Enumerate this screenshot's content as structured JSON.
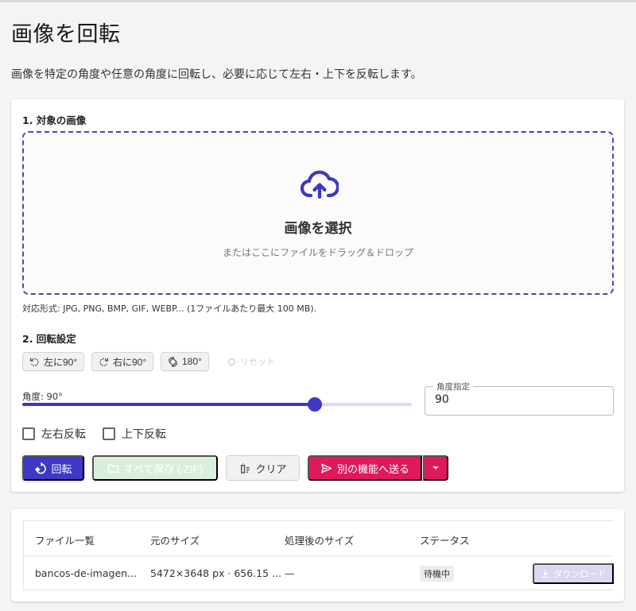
{
  "page": {
    "title": "画像を回転",
    "description": "画像を特定の角度や任意の角度に回転し、必要に応じて左右・上下を反転します。"
  },
  "upload": {
    "section_title": "1. 対象の画像",
    "dropzone_title": "画像を選択",
    "dropzone_subtitle": "またはここにファイルをドラッグ＆ドロップ",
    "formats_note": "対応形式: JPG, PNG, BMP, GIF, WEBP... (1ファイルあたり最大 100 MB).",
    "icon": "cloud-upload-icon"
  },
  "rotation": {
    "section_title": "2. 回転設定",
    "buttons": {
      "left90": "左に90°",
      "right90": "右に90°",
      "rotate180": "180°",
      "reset": "リセット"
    },
    "slider_label": "角度: 90°",
    "slider_value": 90,
    "slider_min": -180,
    "slider_max": 180,
    "angle_field_label": "角度指定",
    "angle_field_value": "90",
    "flip_horizontal_label": "左右反転",
    "flip_vertical_label": "上下反転",
    "flip_horizontal_checked": false,
    "flip_vertical_checked": false
  },
  "actions": {
    "rotate": "回転",
    "save_all": "すべて保存 (.ZIP)",
    "clear": "クリア",
    "send": "別の機能へ送る"
  },
  "table": {
    "headers": [
      "ファイル一覧",
      "元のサイズ",
      "処理後のサイズ",
      "ステータス"
    ],
    "rows": [
      {
        "file": "bancos-de-imagen...",
        "original": "5472×3648 px · 656.15 ...",
        "processed": "—",
        "status": "待機中",
        "download": "ダウンロード"
      }
    ]
  },
  "colors": {
    "primary": "#3f38c4",
    "accent": "#e0195f",
    "dropzone_border": "#4b44b8"
  }
}
